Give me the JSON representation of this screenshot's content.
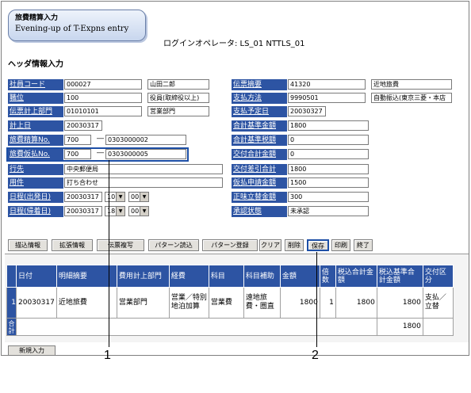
{
  "title": {
    "jp": "旅費精算入力",
    "en": "Evening-up of T-Expns entry"
  },
  "operator": "ログインオペレータ: LS_01 NTTLS_01",
  "section": "ヘッダ情報入力",
  "left": {
    "shain_code": {
      "label": "社員コード",
      "value": "000027",
      "name": "山田二郎"
    },
    "shokui": {
      "label": "職位",
      "value": "100",
      "name": "役員(取締役以上)"
    },
    "keijo_bumon": {
      "label": "伝票計上部門",
      "value": "01010101",
      "name": "営業部門"
    },
    "keijobi": {
      "label": "計上日",
      "value": "20030317"
    },
    "seisan_no": {
      "label": "旅費精算No.",
      "a": "700",
      "b": "0303000002"
    },
    "karibarai_no": {
      "label": "旅費仮払No.",
      "a": "700",
      "b": "0303000005"
    },
    "ikisaki": {
      "label": "行先",
      "value": "中央郵便局"
    },
    "yoken": {
      "label": "用件",
      "value": "打ち合わせ"
    },
    "nittei_start": {
      "label": "日程(出発日)",
      "date": "20030317",
      "h": "10",
      "m": "00"
    },
    "nittei_end": {
      "label": "日程(帰着日)",
      "date": "20030317",
      "h": "18",
      "m": "00"
    }
  },
  "right": {
    "tekiyo": {
      "label": "伝票摘要",
      "value": "41320",
      "name": "近地旅費"
    },
    "shiharai": {
      "label": "支払方法",
      "value": "9990501",
      "name": "自動振込(東京三菱・本店"
    },
    "yoteibi": {
      "label": "支払予定日",
      "value": "20030327"
    },
    "goukei_kijun": {
      "label": "合計基準金額",
      "value": "1800"
    },
    "goukei_kijun_tax": {
      "label": "合計基準税額",
      "value": "0"
    },
    "koufu_goukei": {
      "label": "交付合計金額",
      "value": "0"
    },
    "koufu_sashihiki": {
      "label": "交付差引合計",
      "value": "1800"
    },
    "karibarai_shinsei": {
      "label": "仮払申請金額",
      "value": "1500"
    },
    "shoumi_tatekae": {
      "label": "正味立替金額",
      "value": "300"
    },
    "shounin": {
      "label": "承認状態",
      "value": "未承認"
    }
  },
  "buttons": [
    "描込情報",
    "拡張情報",
    "伝票複写",
    "パターン読込",
    "パターン登録",
    "クリア",
    "削除",
    "保存",
    "印刷",
    "終了"
  ],
  "grid": {
    "headers": [
      "日付",
      "明細摘要",
      "費用計上部門",
      "経費",
      "科目",
      "科目補助",
      "金額",
      "倍数",
      "税込合計金額",
      "税込基準合計金額",
      "交付区分"
    ],
    "row": {
      "no": "1",
      "date": "20030317",
      "tekiyo": "近地旅費",
      "bumon": "営業部門",
      "keihi": "営業／特別地泊加算",
      "kamoku": "営業費",
      "hojo": "遠地旅費・圏直",
      "kingaku": "1800",
      "baisu": "1",
      "zeikomi": "1800",
      "kijun": "1800",
      "koufu": "支払／立替"
    },
    "total_label": "合計",
    "total_kijun": "1800"
  },
  "new_button": "新規入力",
  "callouts": [
    "1",
    "2"
  ]
}
